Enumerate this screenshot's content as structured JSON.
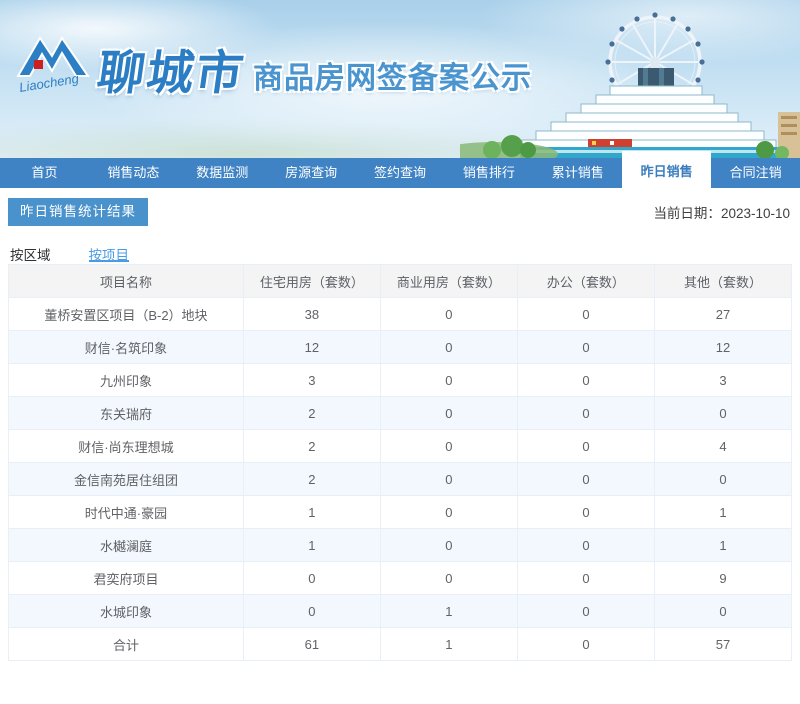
{
  "header": {
    "logo_text": "Liaocheng",
    "city_name": "聊城市",
    "site_title": "商品房网签备案公示"
  },
  "nav": {
    "items": [
      {
        "label": "首页",
        "active": false
      },
      {
        "label": "销售动态",
        "active": false
      },
      {
        "label": "数据监测",
        "active": false
      },
      {
        "label": "房源查询",
        "active": false
      },
      {
        "label": "签约查询",
        "active": false
      },
      {
        "label": "销售排行",
        "active": false
      },
      {
        "label": "累计销售",
        "active": false
      },
      {
        "label": "昨日销售",
        "active": true
      },
      {
        "label": "合同注销",
        "active": false
      }
    ]
  },
  "page": {
    "section_title": "昨日销售统计结果",
    "date_label": "当前日期：",
    "date_value": "2023-10-10"
  },
  "tabs": {
    "items": [
      {
        "label": "按区域",
        "active": false
      },
      {
        "label": "按项目",
        "active": true
      }
    ]
  },
  "table": {
    "columns": [
      "项目名称",
      "住宅用房（套数）",
      "商业用房（套数）",
      "办公（套数）",
      "其他（套数）"
    ],
    "rows": [
      {
        "name": "董桥安置区项目（B-2）地块",
        "values": [
          38,
          0,
          0,
          27
        ],
        "total": false
      },
      {
        "name": "财信·名筑印象",
        "values": [
          12,
          0,
          0,
          12
        ],
        "total": false
      },
      {
        "name": "九州印象",
        "values": [
          3,
          0,
          0,
          3
        ],
        "total": false
      },
      {
        "name": "东关瑞府",
        "values": [
          2,
          0,
          0,
          0
        ],
        "total": false
      },
      {
        "name": "财信·尚东理想城",
        "values": [
          2,
          0,
          0,
          4
        ],
        "total": false
      },
      {
        "name": "金信南苑居住组团",
        "values": [
          2,
          0,
          0,
          0
        ],
        "total": false
      },
      {
        "name": "时代中通·豪园",
        "values": [
          1,
          0,
          0,
          1
        ],
        "total": false
      },
      {
        "name": "水樾澜庭",
        "values": [
          1,
          0,
          0,
          1
        ],
        "total": false
      },
      {
        "name": "君奕府项目",
        "values": [
          0,
          0,
          0,
          9
        ],
        "total": false
      },
      {
        "name": "水城印象",
        "values": [
          0,
          1,
          0,
          0
        ],
        "total": false
      },
      {
        "name": "合计",
        "values": [
          61,
          1,
          0,
          57
        ],
        "total": true
      }
    ]
  },
  "colors": {
    "nav_background": "#3f83c5",
    "nav_active_text": "#3c7ebd",
    "section_title_background": "#4a92cb",
    "tab_active": "#4a9de4",
    "table_header_background": "#f4f4f5",
    "table_stripe": "#f2f8fd",
    "table_border": "#e8eff7",
    "table_text": "#606266",
    "brand_blue": "#2b7ec4"
  }
}
